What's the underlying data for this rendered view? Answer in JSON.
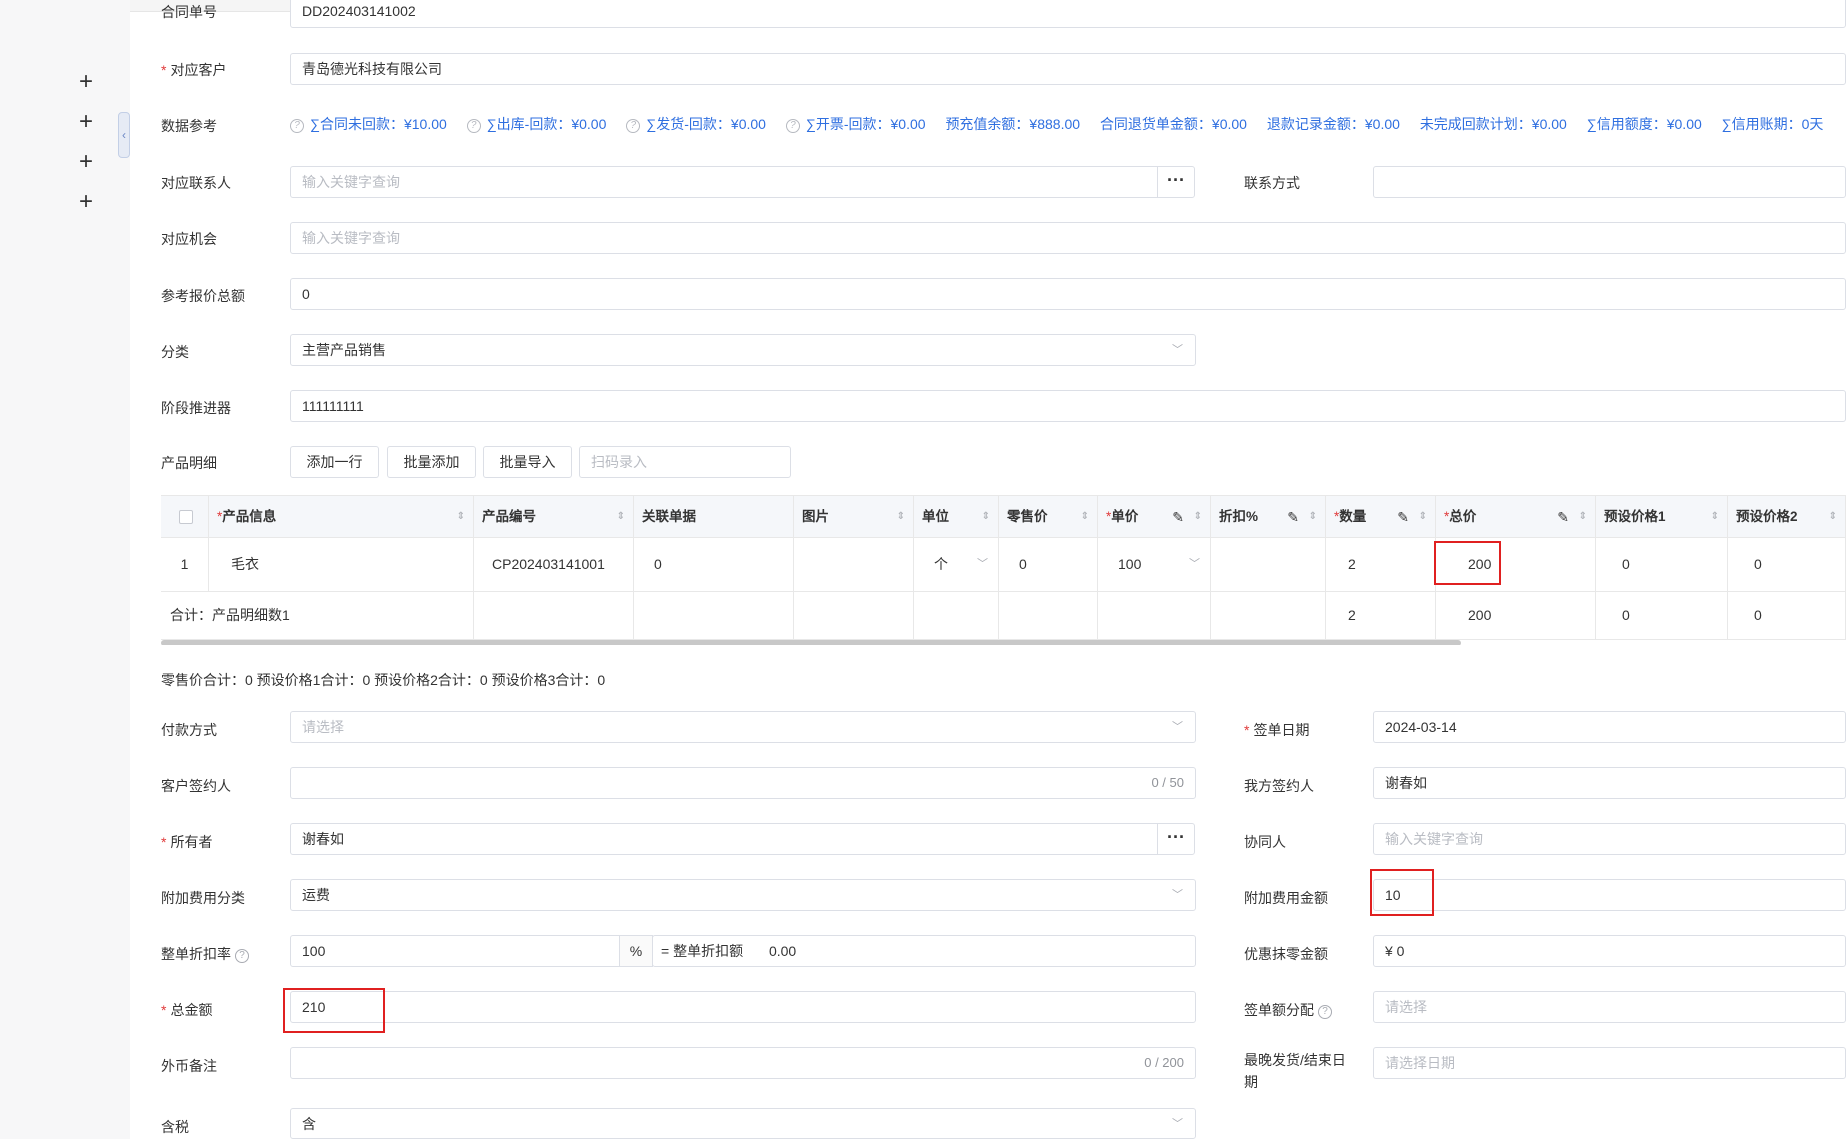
{
  "sidebar": {
    "plus": [
      "+",
      "+",
      "+",
      "+"
    ],
    "collapse": "《"
  },
  "contract_no": {
    "label": "合同单号",
    "value": "DD202403141002"
  },
  "customer": {
    "label": "对应客户",
    "value": "青岛德光科技有限公司"
  },
  "data_ref": {
    "label": "数据参考",
    "items": [
      {
        "help": true,
        "text": "∑合同未回款：¥10.00"
      },
      {
        "help": true,
        "text": "∑出库-回款：¥0.00"
      },
      {
        "help": true,
        "text": "∑发货-回款：¥0.00"
      },
      {
        "help": true,
        "text": "∑开票-回款：¥0.00"
      },
      {
        "help": false,
        "text": "预充值余额：¥888.00"
      },
      {
        "help": false,
        "text": "合同退货单金额：¥0.00"
      },
      {
        "help": false,
        "text": "退款记录金额：¥0.00"
      },
      {
        "help": false,
        "text": "未完成回款计划：¥0.00"
      },
      {
        "help": false,
        "text": "∑信用额度：¥0.00"
      },
      {
        "help": false,
        "text": "∑信用账期：0天"
      }
    ]
  },
  "contact": {
    "label": "对应联系人",
    "placeholder": "输入关键字查询",
    "more": "···"
  },
  "contact_method": {
    "label": "联系方式",
    "value": ""
  },
  "opportunity": {
    "label": "对应机会",
    "placeholder": "输入关键字查询"
  },
  "quote_total": {
    "label": "参考报价总额",
    "value": "0"
  },
  "category": {
    "label": "分类",
    "value": "主营产品销售"
  },
  "stage": {
    "label": "阶段推进器",
    "value": "111111111"
  },
  "products": {
    "label": "产品明细",
    "buttons": {
      "add_row": "添加一行",
      "batch_add": "批量添加",
      "batch_import": "批量导入"
    },
    "scan_placeholder": "扫码录入",
    "columns": [
      "产品信息",
      "产品编号",
      "关联单据",
      "图片",
      "单位",
      "零售价",
      "单价",
      "折扣%",
      "数量",
      "总价",
      "预设价格1",
      "预设价格2"
    ],
    "required_mark": "*",
    "rows": [
      {
        "index": "1",
        "info": "毛衣",
        "code": "CP202403141001",
        "related": "0",
        "image": "",
        "unit": "个",
        "retail": "0",
        "price": "100",
        "discount": "",
        "qty": "2",
        "total": "200",
        "preset1": "0",
        "preset2": "0"
      }
    ],
    "footer": {
      "label": "合计：产品明细数1",
      "qty": "2",
      "total": "200",
      "preset1": "0",
      "preset2": "0"
    }
  },
  "summary_line": "零售价合计：0  预设价格1合计：0  预设价格2合计：0  预设价格3合计：0",
  "payment": {
    "label": "付款方式",
    "placeholder": "请选择"
  },
  "sign_date": {
    "label": "签单日期",
    "value": "2024-03-14"
  },
  "customer_signer": {
    "label": "客户签约人",
    "value": "",
    "count": "0 / 50"
  },
  "our_signer": {
    "label": "我方签约人",
    "value": "谢春如"
  },
  "owner": {
    "label": "所有者",
    "value": "谢春如",
    "more": "···"
  },
  "collaborator": {
    "label": "协同人",
    "placeholder": "输入关键字查询"
  },
  "extra_fee_type": {
    "label": "附加费用分类",
    "value": "运费"
  },
  "extra_fee_amount": {
    "label": "附加费用金额",
    "value": "10"
  },
  "discount_rate": {
    "label": "整单折扣率",
    "value": "100",
    "unit": "%",
    "eq_label": "= 整单折扣额",
    "eq_value": "0.00"
  },
  "rounding": {
    "label": "优惠抹零金额",
    "value": "¥  0"
  },
  "total_amount": {
    "label": "总金额",
    "value": "210"
  },
  "sign_alloc": {
    "label": "签单额分配",
    "placeholder": "请选择"
  },
  "fx_note": {
    "label": "外币备注",
    "value": "",
    "count": "0 / 200"
  },
  "latest_ship": {
    "label_1": "最晚发货/结束日",
    "label_2": "期",
    "placeholder": "请选择日期"
  },
  "tax": {
    "label": "含税",
    "value": "含"
  },
  "colors": {
    "accent": "#2f6fe0",
    "required": "#e03a3a",
    "highlight": "#e02020"
  },
  "icons": {
    "chevron": "chevron-down-icon",
    "sort": "sort-icon",
    "edit": "edit-icon",
    "help": "question-circle-icon"
  }
}
